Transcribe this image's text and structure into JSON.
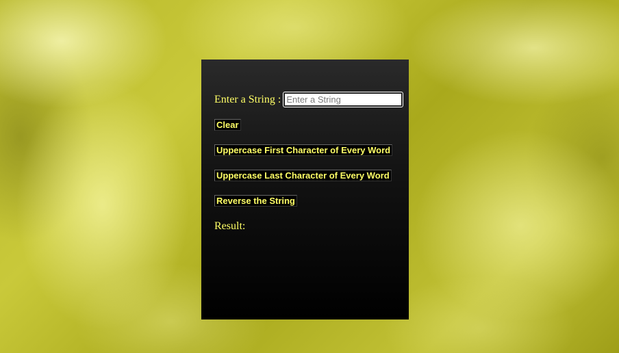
{
  "form": {
    "string_label": "Enter a String :",
    "string_placeholder": "Enter a String",
    "string_value": ""
  },
  "buttons": {
    "clear": "Clear",
    "uppercase_first": "Uppercase First Character of Every Word",
    "uppercase_last": "Uppercase Last Character of Every Word",
    "reverse": "Reverse the String"
  },
  "result": {
    "label": "Result:",
    "value": ""
  },
  "colors": {
    "text_accent": "#ffff66",
    "panel_top": "#2a2a2a",
    "panel_bottom": "#000000",
    "background": "#c2c236"
  }
}
